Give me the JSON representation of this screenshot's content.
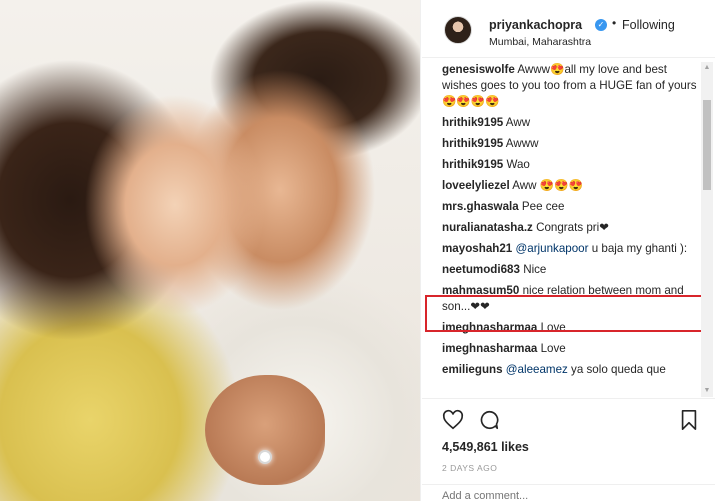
{
  "post": {
    "username": "priyankachopra",
    "follow_status": "Following",
    "location": "Mumbai, Maharashtra"
  },
  "comments": [
    {
      "user": "genesiswolfe",
      "text": " Awww😍all my love and best wishes goes to you too from a HUGE fan of yours😍😍😍😍"
    },
    {
      "user": "hrithik9195",
      "text": " Aww"
    },
    {
      "user": "hrithik9195",
      "text": " Awww"
    },
    {
      "user": "hrithik9195",
      "text": " Wao"
    },
    {
      "user": "loveelyliezel",
      "text": " Aww 😍😍😍"
    },
    {
      "user": "mrs.ghaswala",
      "text": " Pee cee"
    },
    {
      "user": "nuralianatasha.z",
      "text": " Congrats pri❤"
    },
    {
      "user": "mayoshah21",
      "mention": " @arjunkapoor",
      "text": " u baja my ghanti ):"
    },
    {
      "user": "neetumodi683",
      "text": " Nice"
    },
    {
      "user": "mahmasum50",
      "text": " nice relation between mom and son...❤❤"
    },
    {
      "user": "imeghnasharmaa",
      "text": " Love"
    },
    {
      "user": "imeghnasharmaa",
      "text": " Love"
    },
    {
      "user": "emilieguns",
      "mention": " @aleeamez",
      "text": " ya solo queda que"
    }
  ],
  "actions": {
    "like_icon": "heart-outline-icon",
    "comment_icon": "speech-bubble-icon",
    "save_icon": "bookmark-icon",
    "likes_count": "4,549,861 likes",
    "time_ago": "2 DAYS AGO",
    "add_comment_placeholder": "Add a comment..."
  },
  "colors": {
    "verified_badge": "#3897f0",
    "highlight_border": "#d8252b",
    "mention": "#003569"
  }
}
